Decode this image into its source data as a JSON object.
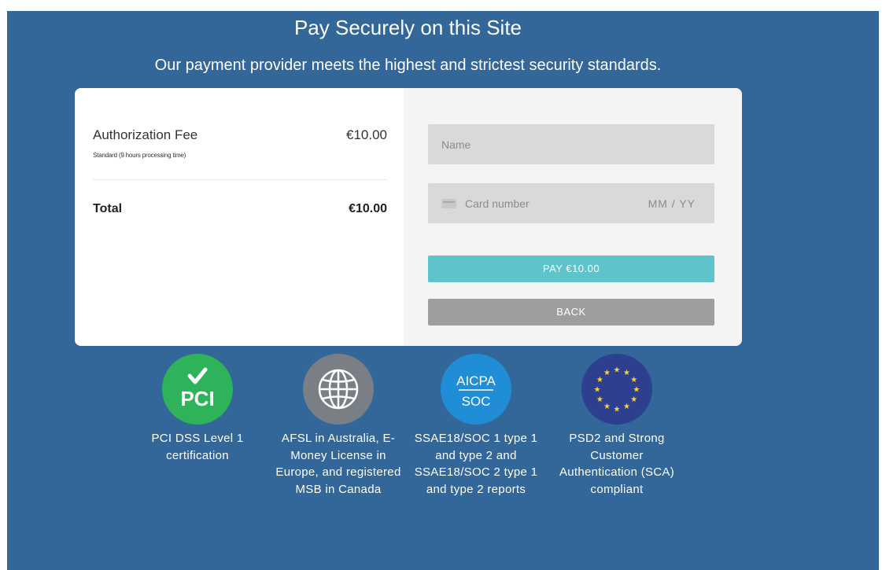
{
  "header": {
    "title": "Pay Securely on this Site",
    "subtitle": "Our payment provider meets the highest and strictest security standards."
  },
  "order": {
    "item_name": "Authorization Fee",
    "item_desc": "Standard (9 hours processing time)",
    "item_price": "€10.00",
    "total_label": "Total",
    "total_price": "€10.00"
  },
  "form": {
    "name_placeholder": "Name",
    "card_placeholder": "Card number",
    "expiry_placeholder": "MM / YY",
    "pay_label": "PAY €10.00",
    "back_label": "BACK"
  },
  "badges": [
    {
      "icon": "pci-icon",
      "icon_text": "PCI",
      "text": "PCI DSS Level 1 certification"
    },
    {
      "icon": "globe-icon",
      "text": "AFSL in Australia, E-Money License in Europe, and registered MSB in Canada"
    },
    {
      "icon": "aicpa-soc-icon",
      "icon_text": "AICPA",
      "icon_text2": "SOC",
      "text": "SSAE18/SOC 1 type 1 and type 2 and SSAE18/SOC 2 type 1 and type 2 reports"
    },
    {
      "icon": "eu-stars-icon",
      "text": "PSD2 and Strong Customer Authentication (SCA) compliant"
    }
  ],
  "colors": {
    "background": "#336699",
    "pay_button": "#5ec4cc",
    "back_button": "#9e9e9e",
    "pci": "#2eb35a",
    "aicpa": "#1f8ed6",
    "eu": "#2f3f8f"
  }
}
